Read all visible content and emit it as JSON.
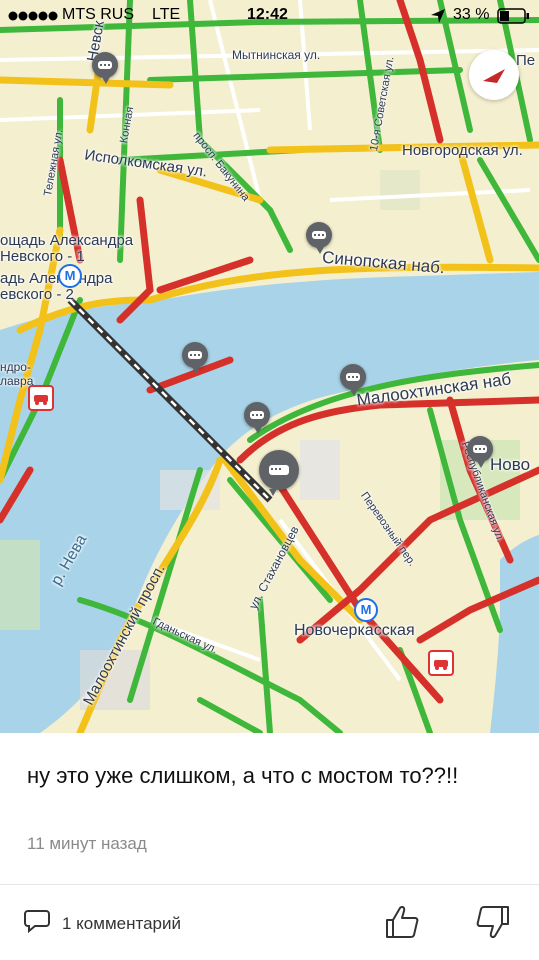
{
  "status_bar": {
    "carrier": "MTS RUS",
    "network": "LTE",
    "time": "12:42",
    "battery": "33 %"
  },
  "map": {
    "labels": {
      "nevsky": "Невск",
      "mytninskaya": "Мытнинская ул.",
      "konnaya": "Конная",
      "telezhnaya": "Тележная ул.",
      "ispolkomskaya": "Исполкомская ул.",
      "bakunina": "просп. Бакунина",
      "sovetskaya": "10-я Советская ул.",
      "novgorodskaya": "Новгородская ул.",
      "ploshchad1": "ощадь Александра\nНевского - 1",
      "ploshchad2": "адь Александра\nевского - 2",
      "sinopskaya": "Синопская наб.",
      "malookhtinskaya_nab": "Малоохтинская наб",
      "novo_right": "Ново",
      "respublikanskaya": "Республиканская ул.",
      "perevoznyi": "Перевозный пер.",
      "neva": "р. Нева",
      "malookhtinsky_prosp": "Малоохтинский просп.",
      "stakhanovtsev": "ул. Стахановцев",
      "novocherkasskaya": "Новочеркасская",
      "bolshaya": "Гданьская ул.",
      "andro": "ндро-\nлавра",
      "pe": "Пе"
    },
    "icons": {
      "compass": "compass-icon",
      "comment_pin": "chat-bubble-icon",
      "accident": "car-accident-icon",
      "metro": "metro-icon"
    },
    "metro_letter": "М"
  },
  "comment": {
    "text": "ну это уже слишком, а что с мостом то??!!",
    "time": "11 минут назад"
  },
  "footer": {
    "comments_label": "1 комментарий",
    "like_icon": "thumbs-up-icon",
    "dislike_icon": "thumbs-down-icon"
  },
  "colors": {
    "jam_red": "#d6302a",
    "jam_yellow": "#f2c21a",
    "jam_green": "#3fb73a",
    "water": "#a9d3e8",
    "land": "#f4efcf"
  }
}
